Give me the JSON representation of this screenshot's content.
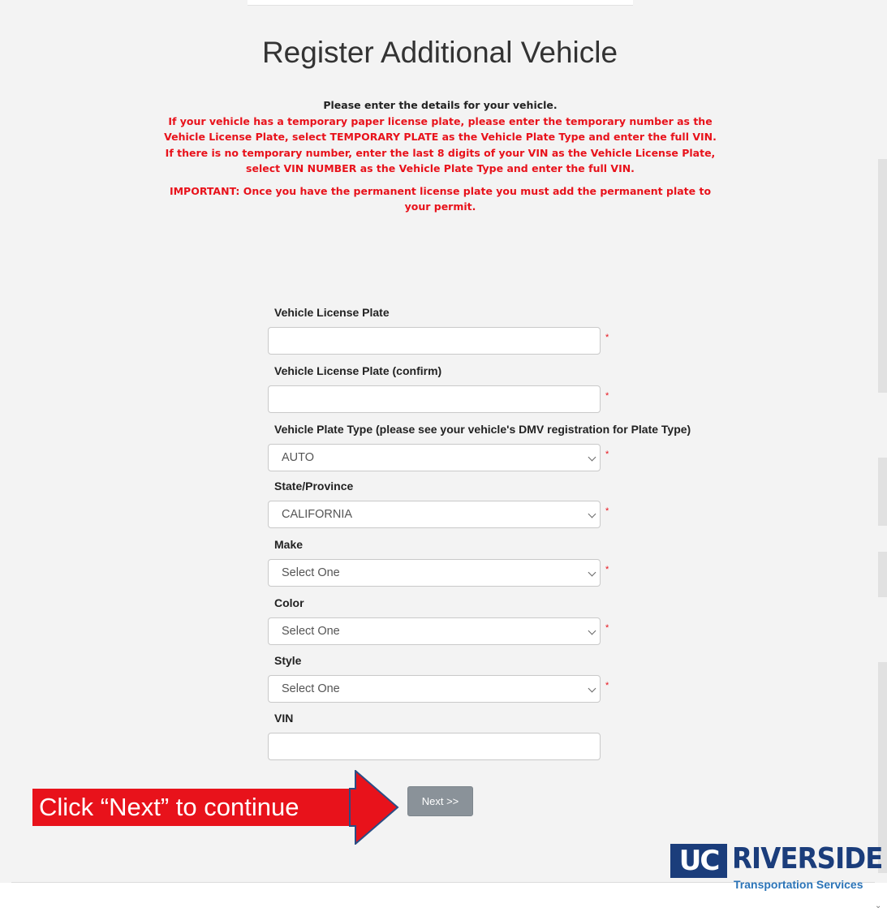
{
  "page": {
    "title": "Register Additional Vehicle"
  },
  "instructions": {
    "lead": "Please enter the details for your vehicle.",
    "body": "If your vehicle has a temporary paper license plate, please enter the temporary number as the Vehicle License Plate, select TEMPORARY PLATE as the Vehicle Plate Type and enter the full VIN. If there is no temporary number, enter the last 8 digits of your VIN as the Vehicle License Plate, select VIN NUMBER as the Vehicle Plate Type and enter the full VIN.",
    "important": "IMPORTANT: Once you have the permanent license plate you must add the permanent plate to your permit."
  },
  "form": {
    "plate": {
      "label": "Vehicle License Plate",
      "value": ""
    },
    "plate_confirm": {
      "label": "Vehicle License Plate (confirm)",
      "value": ""
    },
    "plate_type": {
      "label": "Vehicle Plate Type (please see your vehicle's DMV registration for Plate Type)",
      "value": "AUTO"
    },
    "state": {
      "label": "State/Province",
      "value": "CALIFORNIA"
    },
    "make": {
      "label": "Make",
      "value": "Select One"
    },
    "color": {
      "label": "Color",
      "value": "Select One"
    },
    "style": {
      "label": "Style",
      "value": "Select One"
    },
    "vin": {
      "label": "VIN",
      "value": ""
    },
    "required_marker": "*"
  },
  "actions": {
    "next_label": "Next >>"
  },
  "callout": {
    "text": "Click “Next” to continue",
    "color": "#e8121b"
  },
  "logo": {
    "uc": "UC",
    "name": "RIVERSIDE",
    "subtitle": "Transportation Services",
    "primary_color": "#1b3d7b",
    "secondary_color": "#2b74b8"
  }
}
